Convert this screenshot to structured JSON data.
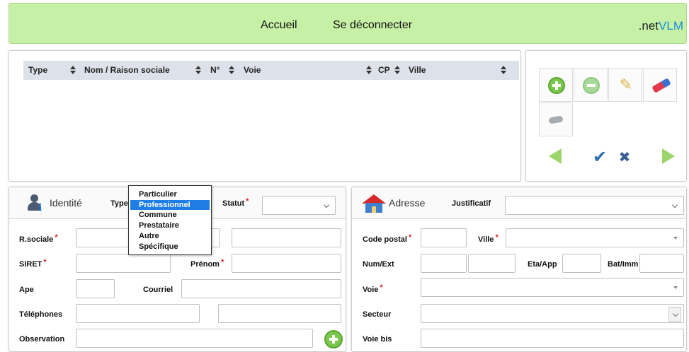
{
  "header": {
    "nav": [
      "Accueil",
      "Se déconnecter"
    ],
    "brand_prefix": ".net",
    "brand_suffix": "VLM"
  },
  "grid": {
    "columns": [
      "Type",
      "Nom / Raison sociale",
      "N°",
      "Voie",
      "CP",
      "Ville"
    ]
  },
  "toolbar": {
    "icons": [
      "add-icon",
      "remove-icon",
      "pencil-icon",
      "eraser-icon",
      "mask-icon",
      "previous-icon",
      "validate-icon",
      "cancel-icon",
      "next-icon"
    ]
  },
  "identity": {
    "title": "Identité",
    "type_label": "Type",
    "statut_label": "Statut",
    "type_options": [
      "Particulier",
      "Professionnel",
      "Commune",
      "Prestataire",
      "Autre",
      "Spécifique"
    ],
    "type_selected": "Professionnel",
    "fields": {
      "rsociale": "R.sociale",
      "siret": "SIRET",
      "prenom": "Prénom",
      "ape": "Ape",
      "courriel": "Courriel",
      "telephones": "Téléphones",
      "observation": "Observation"
    }
  },
  "address": {
    "title": "Adresse",
    "justificatif_label": "Justificatif",
    "fields": {
      "code_postal": "Code postal",
      "ville": "Ville",
      "num_ext": "Num/Ext",
      "eta_app": "Eta/App",
      "bat_imm": "Bat/Imm",
      "voie": "Voie",
      "secteur": "Secteur",
      "voie_bis": "Voie bis"
    }
  },
  "colors": {
    "header_bg": "#c6f0a5",
    "accent_green": "#7bc64c",
    "brand_blue": "#1a8fd8",
    "required_red": "#e02020",
    "selection_blue": "#1f7ee6"
  }
}
